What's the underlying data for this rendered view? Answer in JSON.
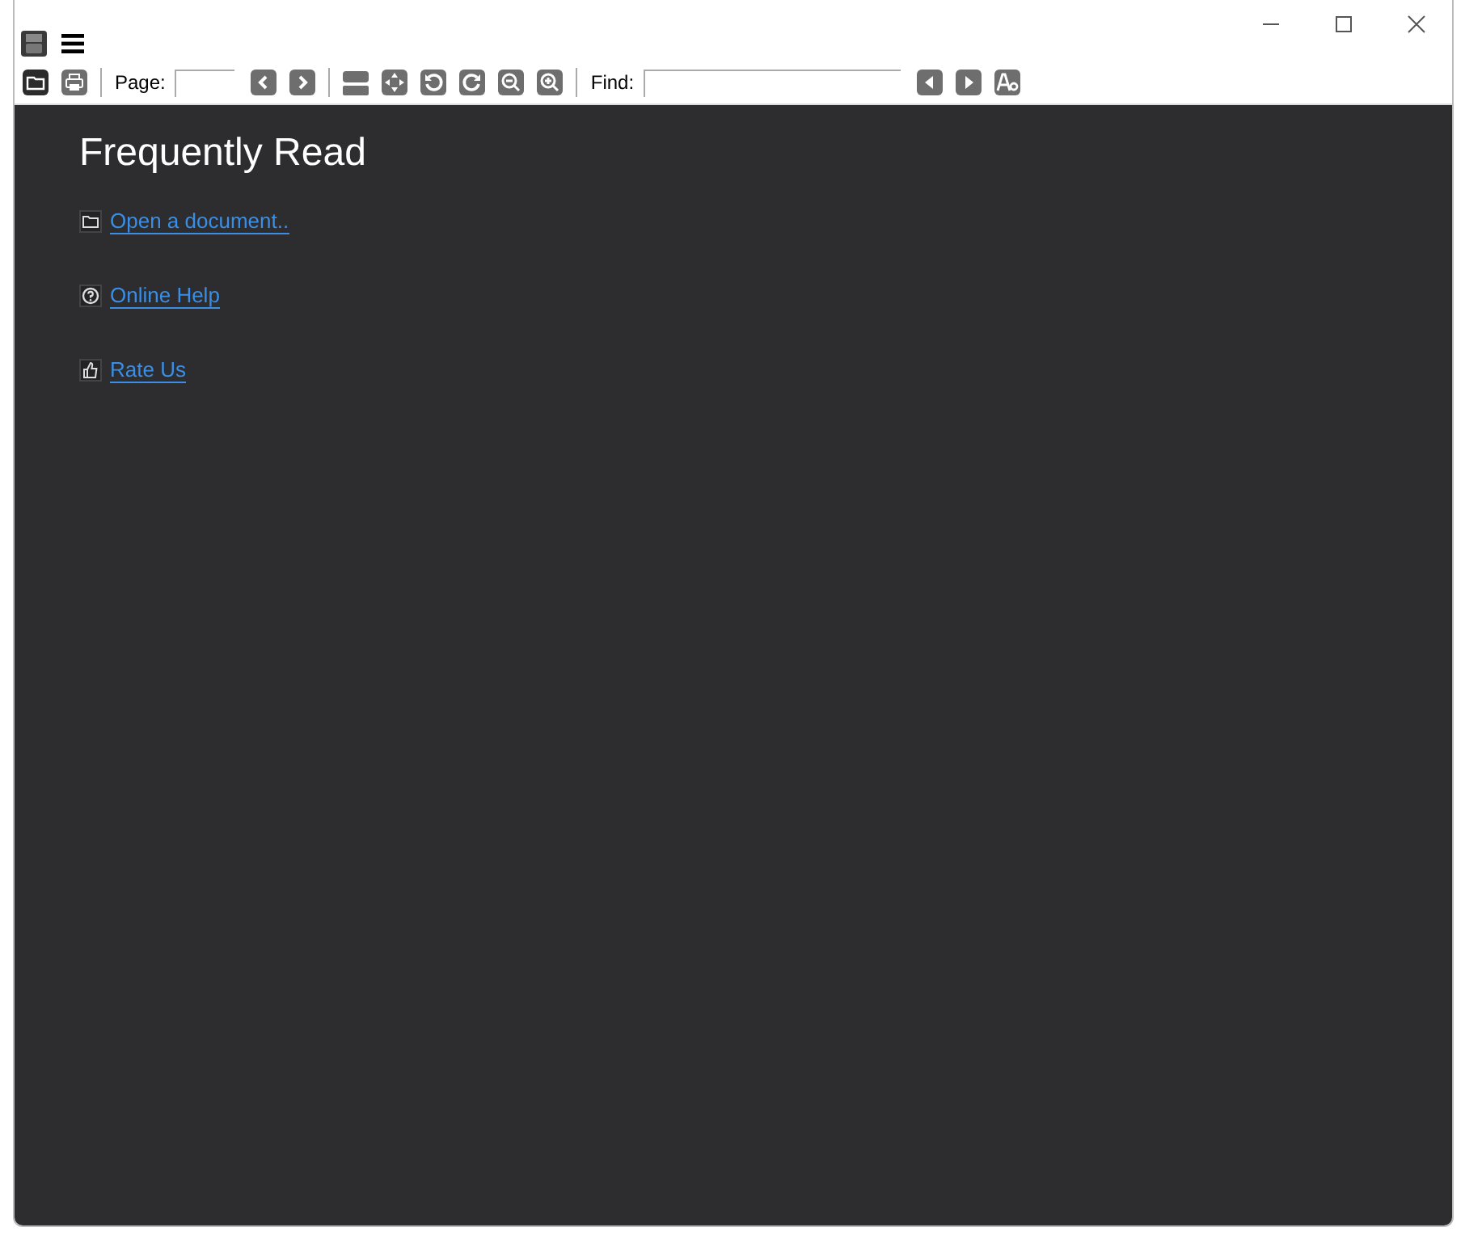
{
  "toolbar": {
    "page_label": "Page:",
    "find_label": "Find:"
  },
  "heading": "Frequently Read",
  "links": [
    {
      "kind": "open",
      "label": "Open a document.."
    },
    {
      "kind": "help",
      "label": "Online Help"
    },
    {
      "kind": "rate",
      "label": "Rate Us"
    }
  ]
}
